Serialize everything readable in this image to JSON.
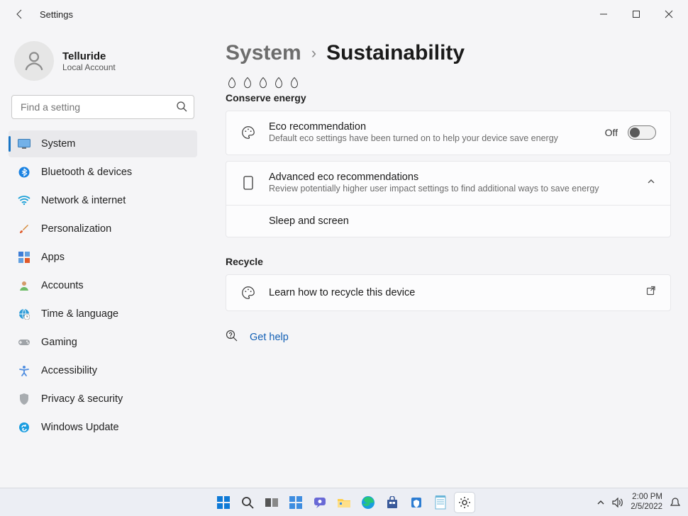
{
  "titlebar": {
    "title": "Settings"
  },
  "account": {
    "name": "Telluride",
    "sub": "Local Account"
  },
  "search": {
    "placeholder": "Find a setting"
  },
  "nav": {
    "items": [
      {
        "label": "System"
      },
      {
        "label": "Bluetooth & devices"
      },
      {
        "label": "Network & internet"
      },
      {
        "label": "Personalization"
      },
      {
        "label": "Apps"
      },
      {
        "label": "Accounts"
      },
      {
        "label": "Time & language"
      },
      {
        "label": "Gaming"
      },
      {
        "label": "Accessibility"
      },
      {
        "label": "Privacy & security"
      },
      {
        "label": "Windows Update"
      }
    ]
  },
  "breadcrumb": {
    "parent": "System",
    "current": "Sustainability"
  },
  "section_conserve": "Conserve energy",
  "eco_rec": {
    "title": "Eco recommendation",
    "desc": "Default eco settings have been turned on to help your device save energy",
    "toggle_label": "Off"
  },
  "adv_eco": {
    "title": "Advanced eco recommendations",
    "desc": "Review potentially higher user impact settings to find additional ways to save energy",
    "child": "Sleep and screen"
  },
  "section_recycle": "Recycle",
  "recycle": {
    "title": "Learn how to recycle this device"
  },
  "help": {
    "label": "Get help"
  },
  "tray": {
    "time": "2:00 PM",
    "date": "2/5/2022"
  }
}
